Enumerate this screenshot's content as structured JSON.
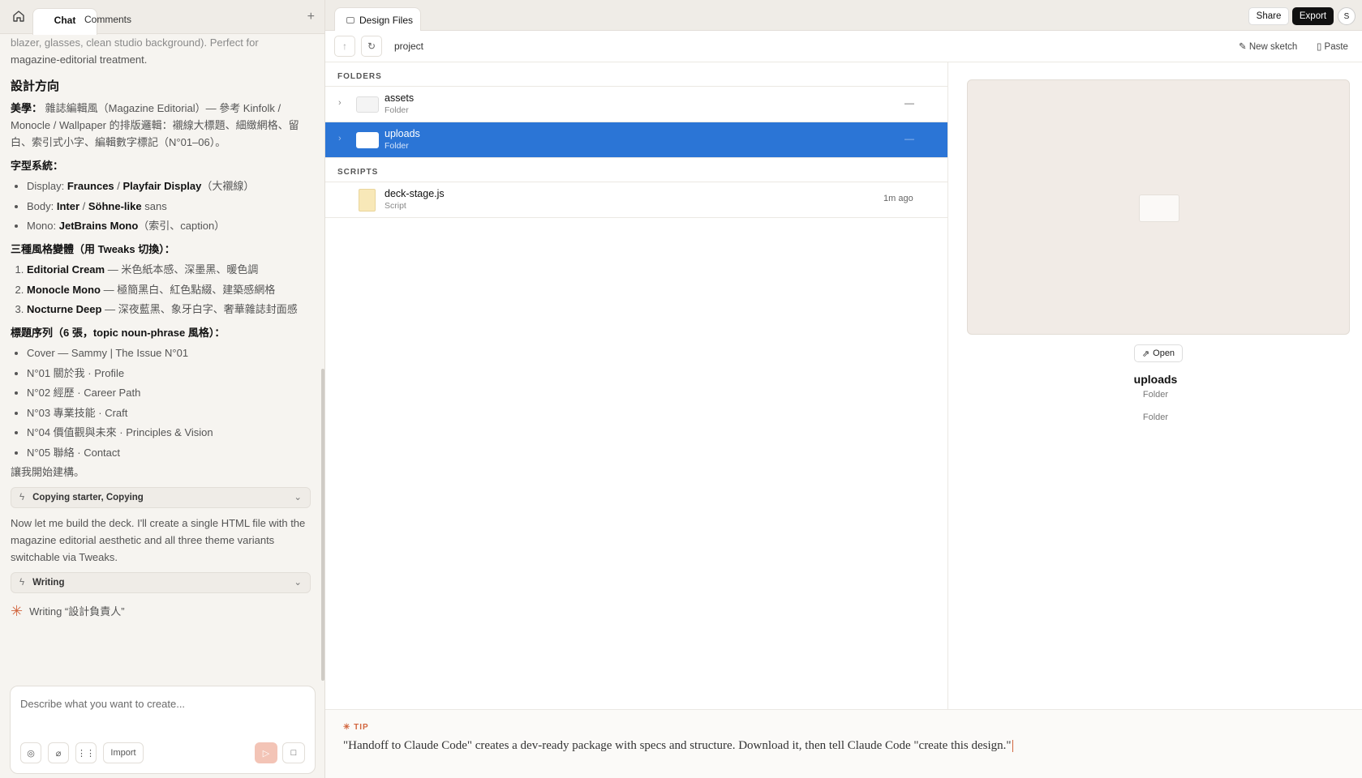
{
  "left_tabs": {
    "chat": "Chat",
    "comments": "Comments"
  },
  "chat": {
    "intro_line1": "blazer, glasses, clean studio background). Perfect for",
    "intro_line2": "magazine-editorial treatment.",
    "design_heading": "設計方向",
    "aesthetic_label": "美學：",
    "aesthetic_text": "雜誌編輯風（Magazine Editorial）— 參考 Kinfolk / Monocle / Wallpaper 的排版邏輯：襯線大標題、細緻網格、留白、索引式小字、編輯數字標記（N°01–06）。",
    "type_label": "字型系統：",
    "type_items": [
      {
        "prefix": "Display: ",
        "b1": "Fraunces",
        "sep": " / ",
        "b2": "Playfair Display",
        "suffix": "（大襯線）"
      },
      {
        "prefix": "Body: ",
        "b1": "Inter",
        "sep": " / ",
        "b2": "Söhne-like",
        "suffix": " sans"
      },
      {
        "prefix": "Mono: ",
        "b1": "JetBrains Mono",
        "sep": "",
        "b2": "",
        "suffix": "（索引、caption）"
      }
    ],
    "variants_label": "三種風格變體（用 Tweaks 切換）：",
    "variants": [
      {
        "name": "Editorial Cream",
        "desc": " — 米色紙本感、深墨黑、暖色調"
      },
      {
        "name": "Monocle Mono",
        "desc": " — 極簡黑白、紅色點綴、建築感網格"
      },
      {
        "name": "Nocturne Deep",
        "desc": " — 深夜藍黑、象牙白字、奢華雜誌封面感"
      }
    ],
    "titles_label": "標題序列（6 張，topic noun-phrase 風格）：",
    "titles": [
      "Cover — Sammy | The Issue N°01",
      "N°01 關於我 · Profile",
      "N°02 經歷 · Career Path",
      "N°03 專業技能 · Craft",
      "N°04 價值觀與未來 · Principles & Vision",
      "N°05 聯絡 · Contact"
    ],
    "start_line": "讓我開始建構。",
    "tool1": "Copying starter, Copying",
    "build_text": "Now let me build the deck. I'll create a single HTML file with the magazine editorial aesthetic and all three theme variants switchable via Tweaks.",
    "tool2": "Writing",
    "writing_status": "Writing “設計負責人”"
  },
  "composer": {
    "placeholder": "Describe what you want to create...",
    "import_label": "Import"
  },
  "topbar": {
    "tab_label": "Design Files",
    "share": "Share",
    "export": "Export",
    "avatar": "S"
  },
  "toolbar": {
    "path": "project",
    "new_sketch": "New sketch",
    "paste": "Paste"
  },
  "folders_heading": "FOLDERS",
  "folders": [
    {
      "name": "assets",
      "type": "Folder",
      "modified": "—"
    },
    {
      "name": "uploads",
      "type": "Folder",
      "modified": "—"
    }
  ],
  "scripts_heading": "SCRIPTS",
  "scripts": [
    {
      "name": "deck-stage.js",
      "type": "Script",
      "modified": "1m ago"
    }
  ],
  "preview": {
    "open_label": "Open",
    "name": "uploads",
    "type": "Folder",
    "kind": "Folder"
  },
  "tip": {
    "label": "TIP",
    "text": "\"Handoff to Claude Code\" creates a dev-ready package with specs and structure. Download it, then tell Claude Code \"create this design.\""
  },
  "colors": {
    "accent": "#d2663f",
    "selection": "#2b75d6"
  }
}
